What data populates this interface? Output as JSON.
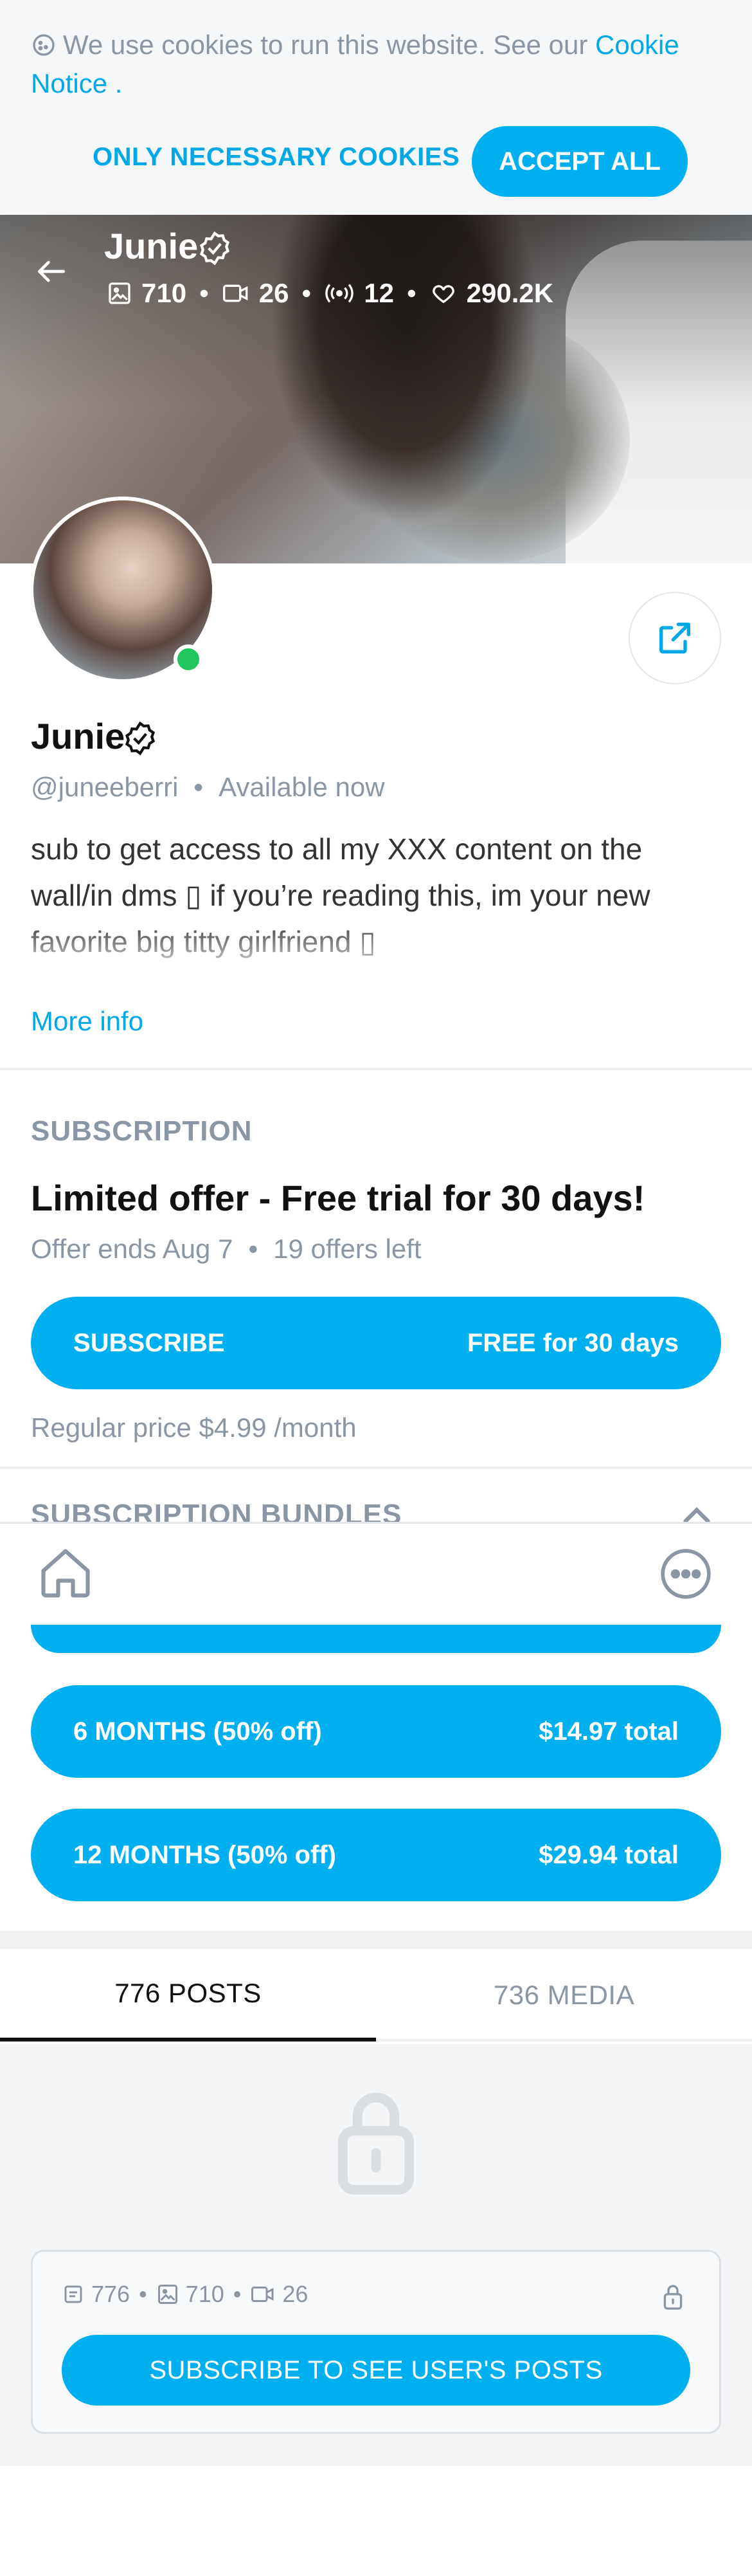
{
  "cookie": {
    "text": "We use cookies to run this website. See our",
    "link": "Cookie Notice",
    "suffix": " .",
    "necessary_label": "ONLY NECESSARY COOKIES",
    "accept_label": "ACCEPT ALL"
  },
  "cover": {
    "name": "Junie",
    "stats": {
      "photos": "710",
      "videos": "26",
      "streams": "12",
      "likes": "290.2K"
    }
  },
  "profile": {
    "name": "Junie",
    "handle": "@juneeberri",
    "status": "Available now",
    "bio": "sub to get access to all my XXX content on the wall/in dms ▯ if you’re reading this, im your new favorite big titty girlfriend ▯",
    "more_info": "More info"
  },
  "subscription": {
    "section_title": "SUBSCRIPTION",
    "offer_title": "Limited offer - Free trial for 30 days!",
    "offer_ends": "Offer ends Aug 7",
    "offers_left": "19 offers left",
    "subscribe_label": "SUBSCRIBE",
    "subscribe_price": "FREE for 30 days",
    "regular_price": "Regular price $4.99 /month"
  },
  "bundles": {
    "section_title": "SUBSCRIPTION BUNDLES",
    "items": [
      {
        "label": "6 MONTHS (50% off)",
        "price": "$14.97 total"
      },
      {
        "label": "12 MONTHS (50% off)",
        "price": "$29.94 total"
      }
    ]
  },
  "tabs": {
    "posts": "776 POSTS",
    "media": "736 MEDIA"
  },
  "locked": {
    "posts": "776",
    "photos": "710",
    "videos": "26",
    "subscribe_label": "SUBSCRIBE TO SEE USER'S POSTS"
  },
  "colors": {
    "accent": "#00aff0",
    "online": "#23c55e",
    "muted": "#8a96a3"
  },
  "icons": [
    "cookie-icon",
    "back-arrow-icon",
    "verified-icon",
    "image-icon",
    "video-icon",
    "stream-icon",
    "heart-icon",
    "share-icon",
    "chevron-up-icon",
    "home-icon",
    "more-icon",
    "lock-icon",
    "post-icon"
  ]
}
